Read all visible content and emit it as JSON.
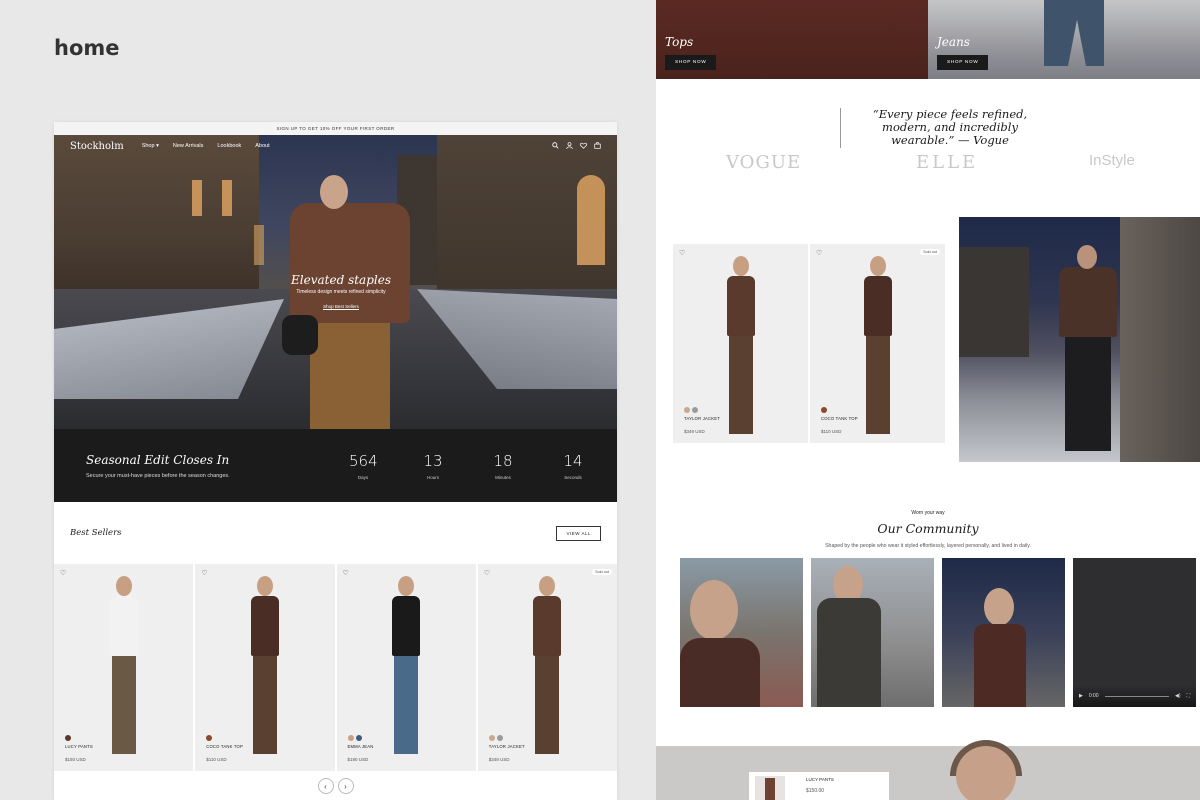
{
  "page_label": "home",
  "announcement": "SIGN UP TO GET 10% OFF YOUR FIRST ORDER",
  "brand": "Stockholm",
  "nav": {
    "items": [
      "Shop ▾",
      "New Arrivals",
      "Lookbook",
      "About"
    ],
    "icons": [
      "search-icon",
      "account-icon",
      "wishlist-icon",
      "cart-icon"
    ]
  },
  "hero": {
    "title": "Elevated staples",
    "subtitle": "Timeless design meets refined simplicity",
    "cta": "Shop Best Sellers"
  },
  "countdown": {
    "title": "Seasonal Edit Closes In",
    "subtitle": "Secure your must-have pieces before the season changes.",
    "units": [
      {
        "value": "564",
        "label": "Days"
      },
      {
        "value": "13",
        "label": "Hours"
      },
      {
        "value": "18",
        "label": "Minutes"
      },
      {
        "value": "14",
        "label": "Seconds"
      }
    ]
  },
  "best_sellers": {
    "title": "Best Sellers",
    "view_all": "VIEW ALL",
    "products": [
      {
        "name": "LUCY PANTS",
        "price": "$150 USD",
        "sold_out": "",
        "swatches": [
          "#5a3a2a"
        ],
        "top_color": "#f2f2f2",
        "leg_color": "#6a5a45"
      },
      {
        "name": "COCO TANK TOP",
        "price": "$110 USD",
        "sold_out": "",
        "swatches": [
          "#8a4a2a"
        ],
        "top_color": "#4a2e26",
        "leg_color": "#5a4030"
      },
      {
        "name": "EMMA JEAN",
        "price": "$190 USD",
        "sold_out": "",
        "swatches": [
          "#c9a080",
          "#3e5a7a"
        ],
        "top_color": "#1a1a1a",
        "leg_color": "#4a6a8a"
      },
      {
        "name": "TAYLOR JACKET",
        "price": "$349 USD",
        "sold_out": "Sold out",
        "swatches": [
          "#c9a88e",
          "#9a9a9a"
        ],
        "top_color": "#5a3a2c",
        "leg_color": "#5a4030"
      }
    ]
  },
  "categories": [
    {
      "label": "Tops",
      "button": "SHOP NOW"
    },
    {
      "label": "Jeans",
      "button": "SHOP NOW"
    }
  ],
  "quote": "“Every piece feels refined, modern, and incredibly wearable.” — Vogue",
  "press": [
    "VOGUE",
    "ELLE",
    "InStyle"
  ],
  "featured_products": [
    {
      "name": "TAYLOR JACKET",
      "price": "$349 USD",
      "sold_out": "",
      "swatches": [
        "#c9a88e",
        "#9a9a9a"
      ],
      "top_color": "#5a3a2c",
      "leg_color": "#5a4030"
    },
    {
      "name": "COCO TANK TOP",
      "price": "$110 USD",
      "sold_out": "Sold out",
      "swatches": [
        "#8a4a2a"
      ],
      "top_color": "#4a2e26",
      "leg_color": "#5a4030"
    }
  ],
  "community": {
    "eyebrow": "Worn your way",
    "title": "Our Community",
    "subtitle": "Shaped by the people who wear it styled effortlessly, layered personally, and lived in daily.",
    "video_time": "0:00"
  },
  "bottom_product": {
    "name": "LUCY PANTS",
    "price": "$150.00"
  }
}
